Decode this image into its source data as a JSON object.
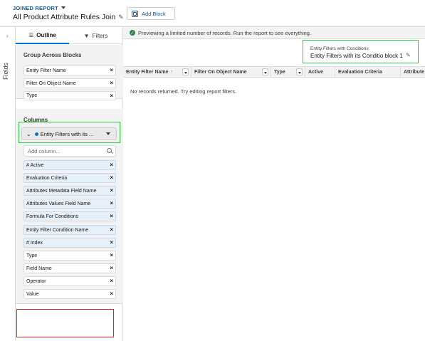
{
  "header": {
    "report_type": "JOINED REPORT",
    "title": "All Product Attribute Rules Join",
    "add_block_label": "Add Block"
  },
  "rail": {
    "label": "Fields"
  },
  "panel": {
    "tabs": [
      {
        "label": "Outline",
        "active": true
      },
      {
        "label": "Filters",
        "active": false
      }
    ],
    "group_across_blocks": {
      "title": "Group Across Blocks",
      "items": [
        "Entity Filter Name",
        "Filter On Object Name",
        "Type"
      ]
    },
    "columns": {
      "title": "Columns",
      "block_select": "Entity Filters with its ...",
      "add_column_placeholder": "Add column...",
      "items": [
        {
          "label": "# Active",
          "highlighted": true
        },
        {
          "label": "Evaluation Criteria",
          "highlighted": true
        },
        {
          "label": "Attributes Metadata Field Name",
          "highlighted": true
        },
        {
          "label": "Attributes Values Field Name",
          "highlighted": true
        },
        {
          "label": "Formula For Conditions",
          "highlighted": true
        },
        {
          "label": "Entity Filter Condition Name",
          "highlighted": true
        },
        {
          "label": "# Index",
          "highlighted": true
        },
        {
          "label": "Type",
          "highlighted": false
        },
        {
          "label": "Field Name",
          "highlighted": false
        },
        {
          "label": "Operator",
          "highlighted": false
        },
        {
          "label": "Value",
          "highlighted": false
        }
      ]
    }
  },
  "main": {
    "preview_message": "Previewing a limited number of records. Run the report to see everything.",
    "block_header": {
      "subtitle": "Entity Filters with Conditions",
      "name": "Entity Filters with its Conditio block 1"
    },
    "table_headers": [
      "Entity Filter Name",
      "Filter On Object Name",
      "Type",
      "Active",
      "Evaluation Criteria",
      "Attribute"
    ],
    "empty_message": "No records returned. Try editing report filters."
  },
  "colors": {
    "accent": "#0176d3",
    "link": "#0b5cab",
    "success": "#2e844a",
    "annotation_green": "#2ecc40",
    "annotation_red": "#e0201b"
  }
}
